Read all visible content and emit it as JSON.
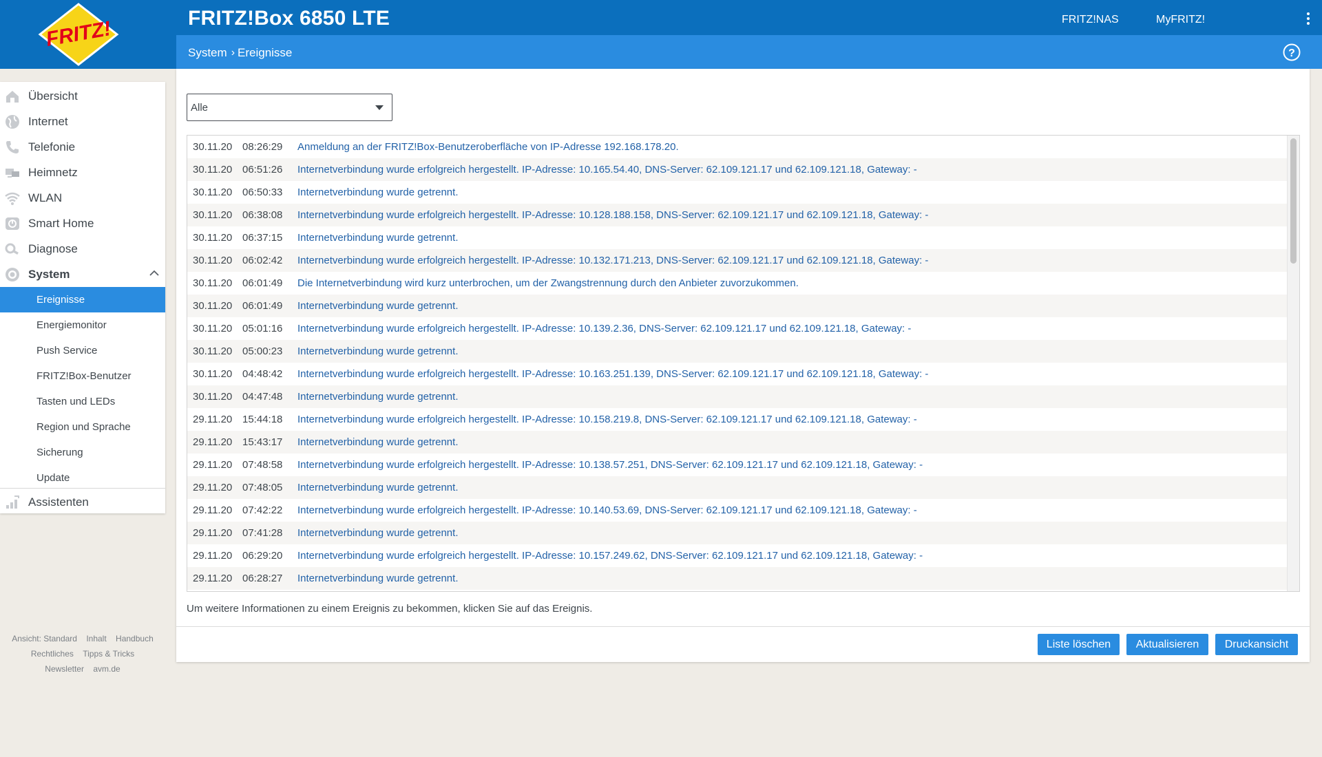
{
  "header": {
    "title": "FRITZ!Box 6850 LTE",
    "links": [
      {
        "label": "FRITZ!NAS"
      },
      {
        "label": "MyFRITZ!"
      }
    ],
    "breadcrumb": [
      "System",
      "Ereignisse"
    ],
    "logo_text": "FRITZ!",
    "colors": {
      "header": "#0b6fbd",
      "subheader": "#2a8ce0",
      "accent": "#2a8ce0",
      "logo_yellow": "#f7d418",
      "logo_red": "#e2001a"
    }
  },
  "sidebar": {
    "items": [
      {
        "label": "Übersicht",
        "icon": "home-icon"
      },
      {
        "label": "Internet",
        "icon": "globe-icon"
      },
      {
        "label": "Telefonie",
        "icon": "phone-icon"
      },
      {
        "label": "Heimnetz",
        "icon": "network-icon"
      },
      {
        "label": "WLAN",
        "icon": "wifi-icon"
      },
      {
        "label": "Smart Home",
        "icon": "smart-home-icon"
      },
      {
        "label": "Diagnose",
        "icon": "diagnose-icon"
      },
      {
        "label": "System",
        "icon": "system-icon",
        "expanded": true
      }
    ],
    "subitems": [
      {
        "label": "Ereignisse",
        "active": true
      },
      {
        "label": "Energiemonitor"
      },
      {
        "label": "Push Service"
      },
      {
        "label": "FRITZ!Box-Benutzer"
      },
      {
        "label": "Tasten und LEDs"
      },
      {
        "label": "Region und Sprache"
      },
      {
        "label": "Sicherung"
      },
      {
        "label": "Update"
      }
    ],
    "assistants": {
      "label": "Assistenten",
      "icon": "wizard-icon"
    }
  },
  "footer": {
    "row1": [
      "Ansicht: Standard",
      "Inhalt",
      "Handbuch"
    ],
    "row2": [
      "Rechtliches",
      "Tipps & Tricks"
    ],
    "row3": [
      "Newsletter",
      "avm.de"
    ]
  },
  "filter": {
    "selected": "Alle"
  },
  "events": [
    {
      "date": "30.11.20",
      "time": "08:26:29",
      "message": "Anmeldung an der FRITZ!Box-Benutzeroberfläche von IP-Adresse 192.168.178.20."
    },
    {
      "date": "30.11.20",
      "time": "06:51:26",
      "message": "Internetverbindung wurde erfolgreich hergestellt. IP-Adresse: 10.165.54.40, DNS-Server: 62.109.121.17 und 62.109.121.18, Gateway: -"
    },
    {
      "date": "30.11.20",
      "time": "06:50:33",
      "message": "Internetverbindung wurde getrennt."
    },
    {
      "date": "30.11.20",
      "time": "06:38:08",
      "message": "Internetverbindung wurde erfolgreich hergestellt. IP-Adresse: 10.128.188.158, DNS-Server: 62.109.121.17 und 62.109.121.18, Gateway: -"
    },
    {
      "date": "30.11.20",
      "time": "06:37:15",
      "message": "Internetverbindung wurde getrennt."
    },
    {
      "date": "30.11.20",
      "time": "06:02:42",
      "message": "Internetverbindung wurde erfolgreich hergestellt. IP-Adresse: 10.132.171.213, DNS-Server: 62.109.121.17 und 62.109.121.18, Gateway: -"
    },
    {
      "date": "30.11.20",
      "time": "06:01:49",
      "message": "Die Internetverbindung wird kurz unterbrochen, um der Zwangstrennung durch den Anbieter zuvorzukommen."
    },
    {
      "date": "30.11.20",
      "time": "06:01:49",
      "message": "Internetverbindung wurde getrennt."
    },
    {
      "date": "30.11.20",
      "time": "05:01:16",
      "message": "Internetverbindung wurde erfolgreich hergestellt. IP-Adresse: 10.139.2.36, DNS-Server: 62.109.121.17 und 62.109.121.18, Gateway: -"
    },
    {
      "date": "30.11.20",
      "time": "05:00:23",
      "message": "Internetverbindung wurde getrennt."
    },
    {
      "date": "30.11.20",
      "time": "04:48:42",
      "message": "Internetverbindung wurde erfolgreich hergestellt. IP-Adresse: 10.163.251.139, DNS-Server: 62.109.121.17 und 62.109.121.18, Gateway: -"
    },
    {
      "date": "30.11.20",
      "time": "04:47:48",
      "message": "Internetverbindung wurde getrennt."
    },
    {
      "date": "29.11.20",
      "time": "15:44:18",
      "message": "Internetverbindung wurde erfolgreich hergestellt. IP-Adresse: 10.158.219.8, DNS-Server: 62.109.121.17 und 62.109.121.18, Gateway: -"
    },
    {
      "date": "29.11.20",
      "time": "15:43:17",
      "message": "Internetverbindung wurde getrennt."
    },
    {
      "date": "29.11.20",
      "time": "07:48:58",
      "message": "Internetverbindung wurde erfolgreich hergestellt. IP-Adresse: 10.138.57.251, DNS-Server: 62.109.121.17 und 62.109.121.18, Gateway: -"
    },
    {
      "date": "29.11.20",
      "time": "07:48:05",
      "message": "Internetverbindung wurde getrennt."
    },
    {
      "date": "29.11.20",
      "time": "07:42:22",
      "message": "Internetverbindung wurde erfolgreich hergestellt. IP-Adresse: 10.140.53.69, DNS-Server: 62.109.121.17 und 62.109.121.18, Gateway: -"
    },
    {
      "date": "29.11.20",
      "time": "07:41:28",
      "message": "Internetverbindung wurde getrennt."
    },
    {
      "date": "29.11.20",
      "time": "06:29:20",
      "message": "Internetverbindung wurde erfolgreich hergestellt. IP-Adresse: 10.157.249.62, DNS-Server: 62.109.121.17 und 62.109.121.18, Gateway: -"
    },
    {
      "date": "29.11.20",
      "time": "06:28:27",
      "message": "Internetverbindung wurde getrennt."
    }
  ],
  "hint": "Um weitere Informationen zu einem Ereignis zu bekommen, klicken Sie auf das Ereignis.",
  "buttons": {
    "clear": "Liste löschen",
    "refresh": "Aktualisieren",
    "print": "Druckansicht"
  }
}
